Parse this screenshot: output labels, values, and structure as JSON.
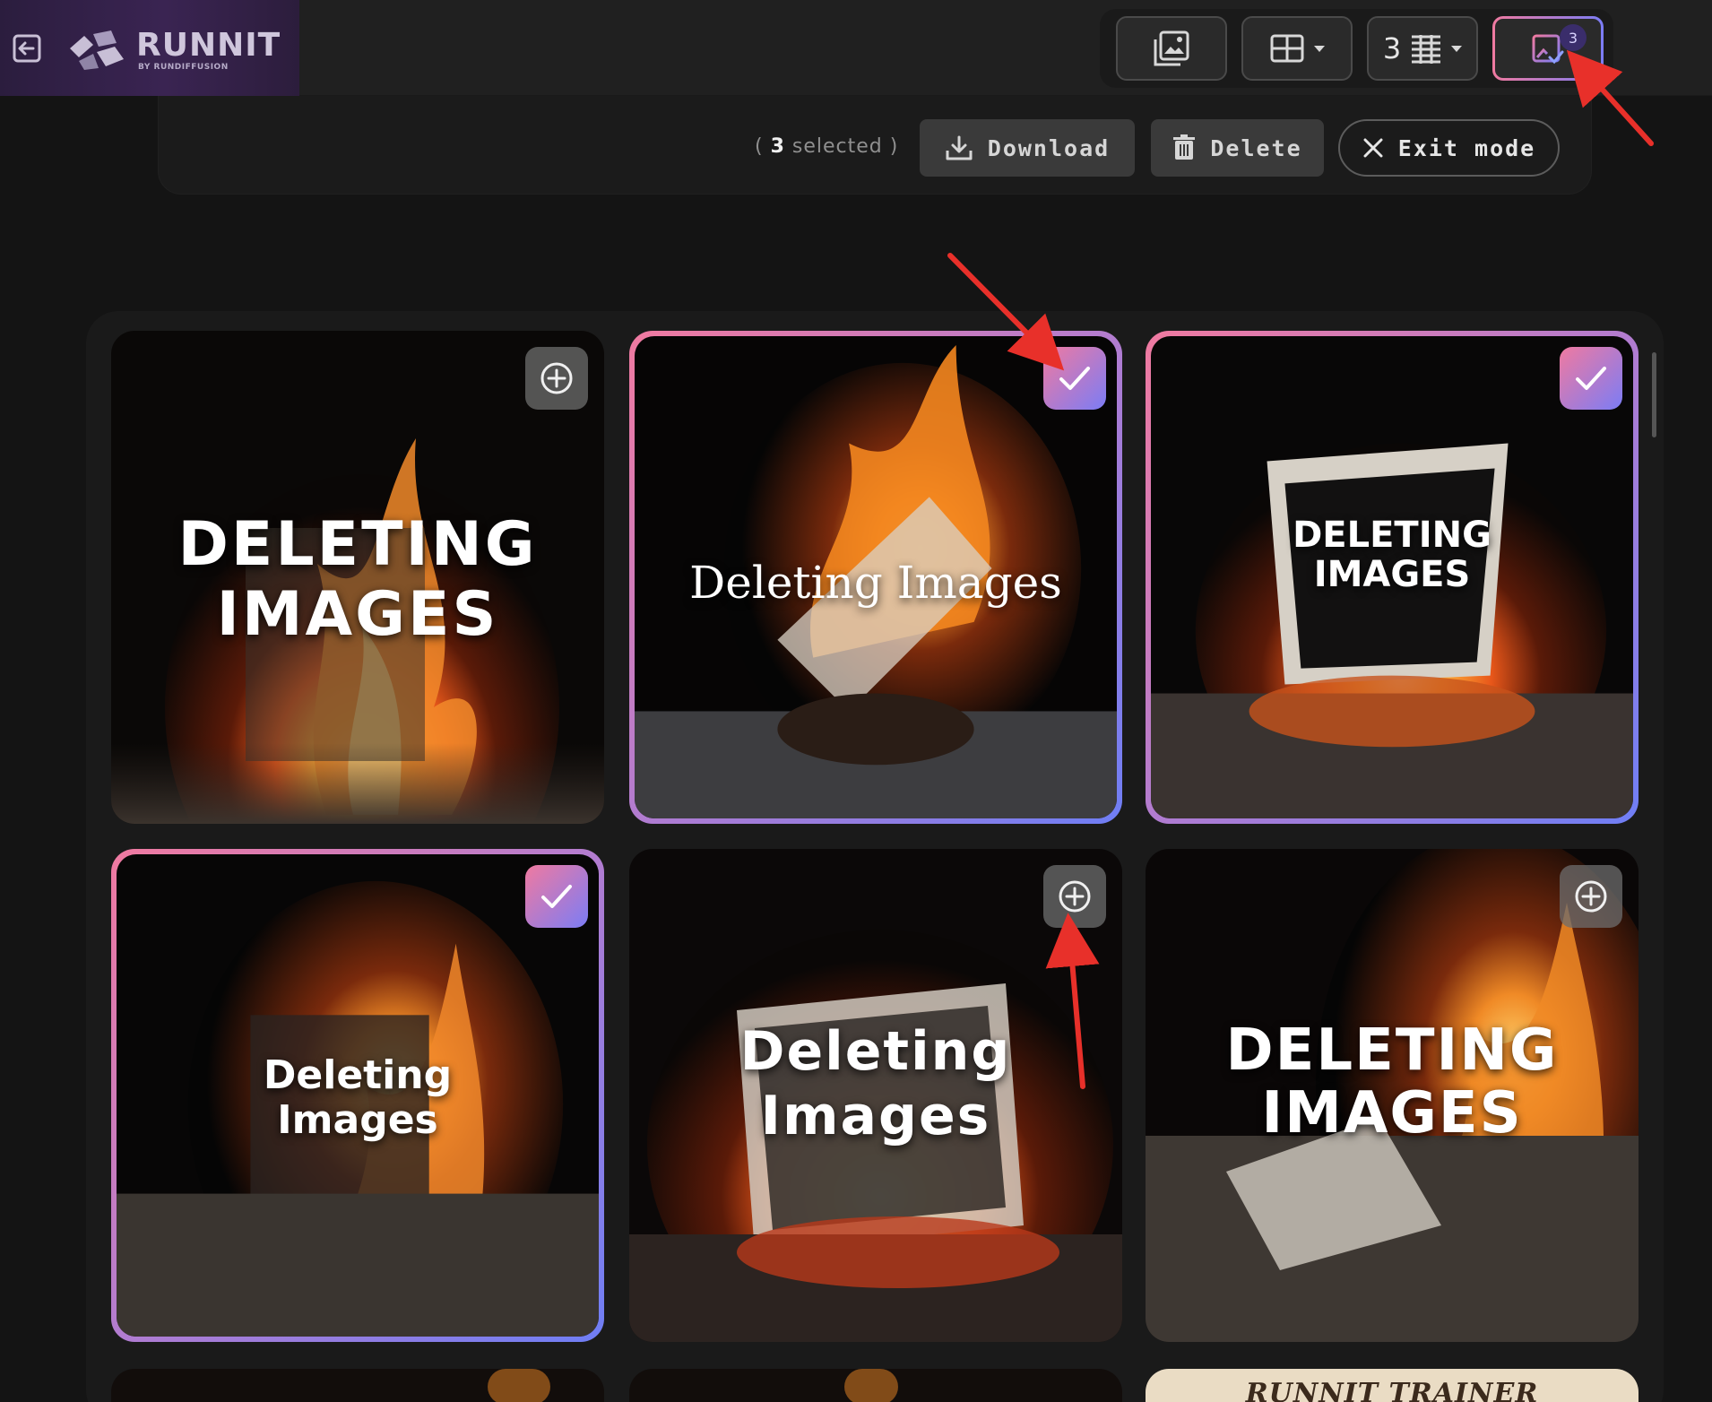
{
  "brand": {
    "name": "RUNNIT",
    "sub": "BY RUNDIFFUSION"
  },
  "icons": {
    "exit": "exit-icon",
    "gallery_view": "image-gallery-icon",
    "grid_view": "grid-icon",
    "columns": "list-columns-icon",
    "select_mode": "select-images-icon",
    "download": "download-icon",
    "delete": "trash-icon",
    "close": "close-icon",
    "add": "plus-circle-icon",
    "check": "check-icon"
  },
  "toolbar": {
    "columns_count": "3",
    "selected_badge": "3"
  },
  "action_bar": {
    "selected_open": "(",
    "selected_count": "3",
    "selected_label": " selected",
    "selected_close": ")",
    "download_label": "Download",
    "delete_label": "Delete",
    "exit_label": "Exit mode"
  },
  "gallery": {
    "cards": [
      {
        "caption": "DELETING\nIMAGES",
        "selected": false
      },
      {
        "caption": "Deleting Images",
        "selected": true
      },
      {
        "caption": "DELETING\nIMAGES",
        "selected": true
      },
      {
        "caption": "Deleting\nImages",
        "selected": true
      },
      {
        "caption": "Deleting\nImages",
        "selected": false
      },
      {
        "caption": "DELETING\nIMAGES",
        "selected": false
      }
    ],
    "peek_label": "RUNNIT TRAINER"
  },
  "colors": {
    "accent_pink": "#f07aa0",
    "accent_blue": "#7b7cf5",
    "background": "#141414",
    "annotation_arrow": "#e8302a"
  }
}
